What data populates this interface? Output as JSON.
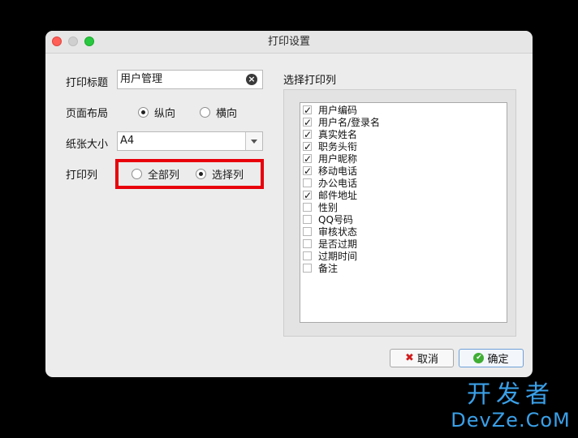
{
  "window": {
    "title": "打印设置"
  },
  "form": {
    "print_title_label": "打印标题",
    "print_title_value": "用户管理",
    "layout_label": "页面布局",
    "layout_options": [
      {
        "label": "纵向",
        "selected": true
      },
      {
        "label": "横向",
        "selected": false
      }
    ],
    "paper_label": "纸张大小",
    "paper_value": "A4",
    "columns_label": "打印列",
    "column_options": [
      {
        "label": "全部列",
        "selected": false
      },
      {
        "label": "选择列",
        "selected": true
      }
    ]
  },
  "column_group": {
    "title": "选择打印列",
    "items": [
      {
        "label": "用户编码",
        "checked": true
      },
      {
        "label": "用户名/登录名",
        "checked": true
      },
      {
        "label": "真实姓名",
        "checked": true
      },
      {
        "label": "职务头衔",
        "checked": true
      },
      {
        "label": "用户昵称",
        "checked": true
      },
      {
        "label": "移动电话",
        "checked": true
      },
      {
        "label": "办公电话",
        "checked": false
      },
      {
        "label": "邮件地址",
        "checked": true
      },
      {
        "label": "性别",
        "checked": false
      },
      {
        "label": "QQ号码",
        "checked": false
      },
      {
        "label": "审核状态",
        "checked": false
      },
      {
        "label": "是否过期",
        "checked": false
      },
      {
        "label": "过期时间",
        "checked": false
      },
      {
        "label": "备注",
        "checked": false
      }
    ]
  },
  "buttons": {
    "cancel": "取消",
    "ok": "确定"
  },
  "watermark": {
    "cn": "开发者",
    "en": "DevZe.CoM"
  },
  "colors": {
    "highlight": "#e8000b",
    "watermark": "#3aa0e8"
  }
}
